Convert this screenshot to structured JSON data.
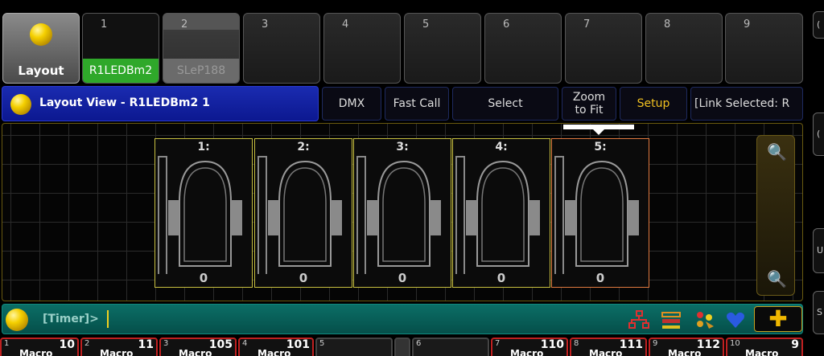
{
  "view_bar": {
    "layout_label": "Layout",
    "tiles": [
      {
        "num": "1",
        "label": "R1LEDBm2"
      },
      {
        "num": "2",
        "label": "SLeP188"
      },
      {
        "num": "3",
        "label": ""
      },
      {
        "num": "4",
        "label": ""
      },
      {
        "num": "5",
        "label": ""
      },
      {
        "num": "6",
        "label": ""
      },
      {
        "num": "7",
        "label": ""
      },
      {
        "num": "8",
        "label": ""
      },
      {
        "num": "9",
        "label": ""
      }
    ]
  },
  "title_bar": {
    "title": "Layout View - R1LEDBm2 1",
    "buttons": {
      "dmx": "DMX",
      "fast_call": "Fast Call",
      "select": "Select",
      "zoom_to_fit": "Zoom to Fit",
      "setup": "Setup",
      "link_selected": "[Link Selected: R"
    }
  },
  "fixtures": [
    {
      "id": "1:",
      "value": "0"
    },
    {
      "id": "2:",
      "value": "0"
    },
    {
      "id": "3:",
      "value": "0"
    },
    {
      "id": "4:",
      "value": "0"
    },
    {
      "id": "5:",
      "value": "0"
    }
  ],
  "command_line": {
    "prompt": "[Timer]>"
  },
  "executors": [
    {
      "num": "1",
      "value": "10",
      "label": "Macro"
    },
    {
      "num": "2",
      "value": "11",
      "label": "Macro"
    },
    {
      "num": "3",
      "value": "105",
      "label": "Macro"
    },
    {
      "num": "4",
      "value": "101",
      "label": "Macro"
    },
    {
      "num": "5",
      "value": "",
      "label": ""
    },
    {
      "num": "6",
      "value": "",
      "label": ""
    },
    {
      "num": "7",
      "value": "110",
      "label": "Macro"
    },
    {
      "num": "8",
      "value": "111",
      "label": "Macro"
    },
    {
      "num": "9",
      "value": "112",
      "label": "Macro"
    },
    {
      "num": "10",
      "value": "9",
      "label": "Macro"
    }
  ],
  "right_strip": {
    "items": [
      "(",
      "(",
      "U",
      "S"
    ]
  },
  "colors": {
    "accent_yellow": "#f0c020",
    "title_blue": "#1a2bb0",
    "command_teal": "#0b6e66",
    "executor_red": "#c02020",
    "active_green": "#2fa82a"
  }
}
